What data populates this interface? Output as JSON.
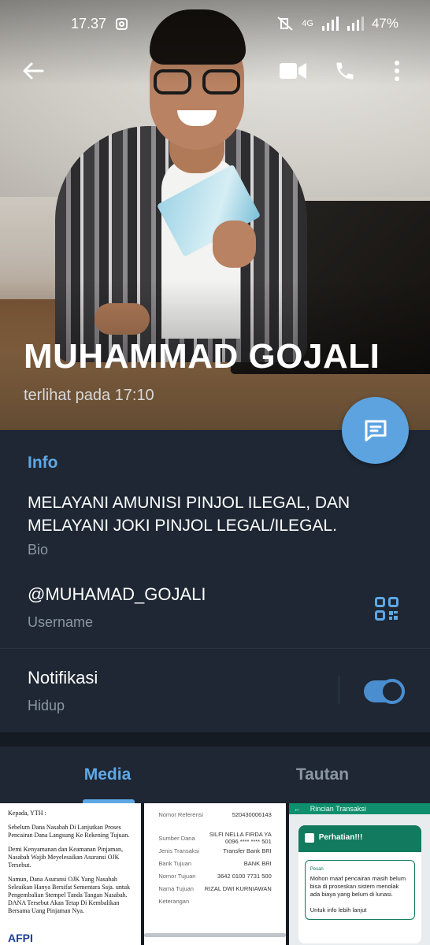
{
  "status_bar": {
    "time": "17.37",
    "network": "4G",
    "battery": "47%"
  },
  "profile": {
    "name": "MUHAMMAD GOJALI",
    "last_seen": "terlihat pada  17:10"
  },
  "info": {
    "title": "Info",
    "bio": "MELAYANI AMUNISI PINJOL ILEGAL, DAN MELAYANI JOKI PINJOL LEGAL/ILEGAL.",
    "bio_label": "Bio",
    "username": "@MUHAMAD_GOJALI",
    "username_label": "Username",
    "notifications": "Notifikasi",
    "notifications_state": "Hidup",
    "notifications_on": true
  },
  "tabs": [
    {
      "label": "Media",
      "active": true
    },
    {
      "label": "Tautan",
      "active": false
    }
  ],
  "media": {
    "doc1": {
      "p1": "Kepada, YTH :",
      "p2": "Sebelum Dana Nasabah Di Lanjutkan Proses Pencairan Dana Langsung Ke Rekening Tujuan.",
      "p3": "Demi Kenyamanan dan Keamanan Pinjaman, Nasabah Wajib Meyelesaikan Asuransi OJK Tersebut.",
      "p4": "Namun, Dana Asuransi OJK Yang Nasabah Seleaikan Hanya Bersifat Sementara Saja. untuk Pengembalian Stempel Tanda Tangan Nasabah. DANA Tersebut Akan Tetap Di Kembalikan Bersama Uang Pinjaman Nya."
    },
    "doc2": {
      "rows": [
        [
          "Nomor Referensi",
          "520430006143"
        ],
        [
          "Sumber Dana",
          "SILFI NELLA FIRDA YA 0096 **** **** 501"
        ],
        [
          "Jenis Transaksi",
          "Transfer Bank BRI"
        ],
        [
          "Bank Tujuan",
          "BANK BRI"
        ],
        [
          "Nomor Tujuan",
          "3642 0100 7731 500"
        ],
        [
          "Nama Tujuan",
          "RIZAL DWI KURNIAWAN"
        ],
        [
          "Keterangan",
          ""
        ]
      ]
    },
    "doc3": {
      "topbar": "Rincian Transaksi",
      "card_title": "Perhatian!!!",
      "notice_label": "Pesan",
      "notice": "Mohon maaf pencairan masih belum bisa di proseskan sistem menolak ada biaya yang belum di lunasi.",
      "notice2": "Untuk info lebih lanjut"
    }
  },
  "colors": {
    "accent": "#5ea8e6",
    "panel": "#1e2733",
    "fab": "#5da3e0"
  }
}
